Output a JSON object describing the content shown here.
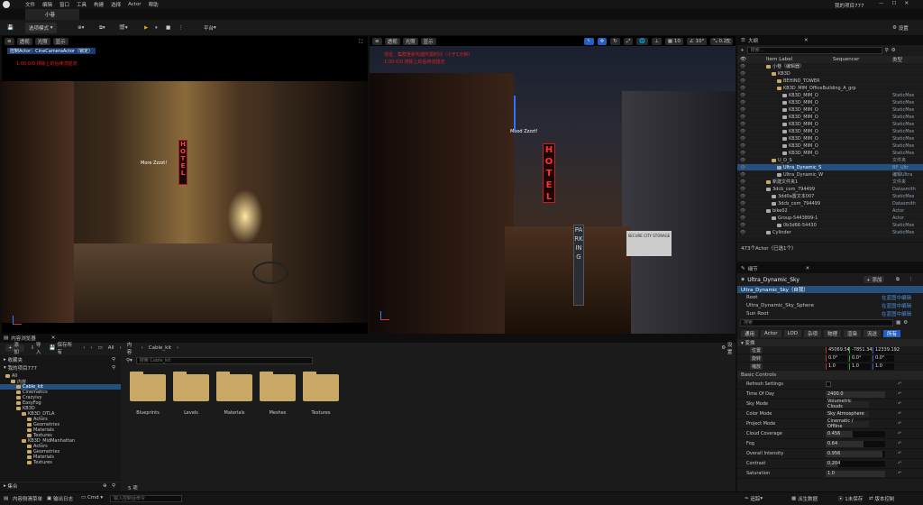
{
  "menu": [
    "文件",
    "编辑",
    "窗口",
    "工具",
    "构建",
    "选择",
    "Actor",
    "帮助"
  ],
  "project_name": "我的项目777",
  "level_tab": "小巷",
  "toolbar": {
    "select_mode": "选项模式",
    "platform": "平台",
    "settings": "设置"
  },
  "viewport_left": {
    "view_mode": "透视",
    "lit": "光照",
    "show": "显示",
    "pilot_text": "控制Actor：CineCameraActor（锁定）",
    "notice": "1:00:0/0 排除上的后续流插流",
    "sign_hotel": "HOTEL",
    "sign_label": "More Zzzzt!"
  },
  "viewport_right": {
    "view_mode": "透视",
    "lit": "光照",
    "show": "显示",
    "error_line1": "地址：集群重新构建所需时间（小于1分钟）",
    "error_line2": "1:00:0/0 排除上的后续流插流",
    "grid": "10",
    "angle": "10°",
    "scale": "0.25",
    "speed": "1",
    "sign_hotel": "HOTEL",
    "sign_parking": "PARKING",
    "sign_label": "Mood Zzzzt!",
    "sign_board": "SECURE CITY STORAGE"
  },
  "outliner": {
    "title": "大纲",
    "search_placeholder": "搜索...",
    "col_label": "Item Label",
    "col_sequencer": "Sequencer",
    "col_type": "类型",
    "rows": [
      {
        "label": "小巷（编辑器）",
        "type": "",
        "indent": 2,
        "sel": false
      },
      {
        "label": "KB3D",
        "type": "",
        "indent": 3,
        "sel": false
      },
      {
        "label": "BEHIND_TOWER",
        "type": "",
        "indent": 4,
        "sel": false
      },
      {
        "label": "KB3D_MIM_OfficeBuilding_A_grp",
        "type": "",
        "indent": 4,
        "sel": false
      },
      {
        "label": "KB3D_MIM_O",
        "type": "StaticMes",
        "indent": 5,
        "sel": false
      },
      {
        "label": "KB3D_MIM_O",
        "type": "StaticMes",
        "indent": 5,
        "sel": false
      },
      {
        "label": "KB3D_MIM_O",
        "type": "StaticMes",
        "indent": 5,
        "sel": false
      },
      {
        "label": "KB3D_MIM_O",
        "type": "StaticMes",
        "indent": 5,
        "sel": false
      },
      {
        "label": "KB3D_MIM_O",
        "type": "StaticMes",
        "indent": 5,
        "sel": false
      },
      {
        "label": "KB3D_MIM_O",
        "type": "StaticMes",
        "indent": 5,
        "sel": false
      },
      {
        "label": "KB3D_MIM_O",
        "type": "StaticMes",
        "indent": 5,
        "sel": false
      },
      {
        "label": "KB3D_MIM_O",
        "type": "StaticMes",
        "indent": 5,
        "sel": false
      },
      {
        "label": "KB3D_MIM_O",
        "type": "StaticMes",
        "indent": 5,
        "sel": false
      },
      {
        "label": "U_D_S",
        "type": "文件夹",
        "indent": 3,
        "sel": false
      },
      {
        "label": "Ultra_Dynamic_S",
        "type": "BP_Ultr",
        "indent": 4,
        "sel": true
      },
      {
        "label": "Ultra_Dynamic_W",
        "type": "编辑Ultra",
        "indent": 4,
        "sel": false
      },
      {
        "label": "新建文件夹1",
        "type": "文件夹",
        "indent": 2,
        "sel": false
      },
      {
        "label": "3dcb_com_794499",
        "type": "Datasmith",
        "indent": 2,
        "sel": false
      },
      {
        "label": "3dd0a置文本007",
        "type": "StaticMes",
        "indent": 3,
        "sel": false
      },
      {
        "label": "3dcb_com_794499",
        "type": "Datasmith",
        "indent": 3,
        "sel": false
      },
      {
        "label": "bike02",
        "type": "Actor",
        "indent": 2,
        "sel": false
      },
      {
        "label": "Group-5443899-1",
        "type": "Actor",
        "indent": 3,
        "sel": false
      },
      {
        "label": "0b3d66-54430",
        "type": "StaticMes",
        "indent": 4,
        "sel": false
      },
      {
        "label": "Cylinder",
        "type": "StaticMes",
        "indent": 2,
        "sel": false
      }
    ],
    "footer": "473个Actor（已选1个）"
  },
  "details": {
    "title": "细节",
    "actor_name": "Ultra_Dynamic_Sky",
    "add_button": "+ 添加",
    "instance": "Ultra_Dynamic_Sky（自我）",
    "components": [
      {
        "name": "Root",
        "action": "在蓝图中编辑"
      },
      {
        "name": "Ultra_Dynamic_Sky_Sphere",
        "action": "在蓝图中编辑"
      },
      {
        "name": "Sun Root",
        "action": "在蓝图中编辑"
      }
    ],
    "search_placeholder": "搜索",
    "category_tabs": [
      "通用",
      "Actor",
      "LOD",
      "杂项",
      "物理",
      "渲染",
      "流送",
      "所有"
    ],
    "transform_title": "变换",
    "transform": [
      {
        "label": "位置",
        "x": "45069.542",
        "y": "-7851.342",
        "z": "12339.192"
      },
      {
        "label": "旋转",
        "x": "0.0°",
        "y": "0.0°",
        "z": "0.0°"
      },
      {
        "label": "缩放",
        "x": "1.0",
        "y": "1.0",
        "z": "1.0"
      }
    ],
    "basic_title": "Basic Controls",
    "props": [
      {
        "label": "Refresh Settings",
        "value": "",
        "kind": "check"
      },
      {
        "label": "Time Of Day",
        "value": "2400.0",
        "kind": "num",
        "fill": 1.0
      },
      {
        "label": "Sky Mode",
        "value": "Volumetric Clouds",
        "kind": "select"
      },
      {
        "label": "Color Mode",
        "value": "Sky Atmosphere",
        "kind": "select"
      },
      {
        "label": "Project Mode",
        "value": "Cinematic / Offline",
        "kind": "select"
      },
      {
        "label": "Cloud Coverage",
        "value": "0.456",
        "kind": "num",
        "fill": 0.456
      },
      {
        "label": "Fog",
        "value": "0.64",
        "kind": "num",
        "fill": 0.64
      },
      {
        "label": "Overall Intensity",
        "value": "0.956",
        "kind": "num",
        "fill": 0.956
      },
      {
        "label": "Contrast",
        "value": "0.204",
        "kind": "num",
        "fill": 0.204
      },
      {
        "label": "Saturation",
        "value": "1.0",
        "kind": "num",
        "fill": 1.0
      }
    ]
  },
  "content_browser": {
    "title": "内容浏览器",
    "add": "添加",
    "import": "导入",
    "save_all": "保存所有",
    "path": [
      "All",
      "内容",
      "Cable_kit"
    ],
    "settings": "设置",
    "favorites": "收藏夹",
    "project": "我的项目777",
    "search_placeholder": "搜索 Cable_kit",
    "tree": [
      {
        "label": "All",
        "indent": 0,
        "sel": false
      },
      {
        "label": "内容",
        "indent": 1,
        "sel": false
      },
      {
        "label": "Cable_kit",
        "indent": 2,
        "sel": true
      },
      {
        "label": "Cinematics",
        "indent": 2,
        "sel": false
      },
      {
        "label": "Crazyivy",
        "indent": 2,
        "sel": false
      },
      {
        "label": "EasyFog",
        "indent": 2,
        "sel": false
      },
      {
        "label": "KB3D",
        "indent": 2,
        "sel": false
      },
      {
        "label": "KB3D_DTLA",
        "indent": 3,
        "sel": false
      },
      {
        "label": "Actors",
        "indent": 4,
        "sel": false
      },
      {
        "label": "Geometries",
        "indent": 4,
        "sel": false
      },
      {
        "label": "Materials",
        "indent": 4,
        "sel": false
      },
      {
        "label": "Textures",
        "indent": 4,
        "sel": false
      },
      {
        "label": "KB3D_MidManhattan",
        "indent": 3,
        "sel": false
      },
      {
        "label": "Actors",
        "indent": 4,
        "sel": false
      },
      {
        "label": "Geometries",
        "indent": 4,
        "sel": false
      },
      {
        "label": "Materials",
        "indent": 4,
        "sel": false
      },
      {
        "label": "Textures",
        "indent": 4,
        "sel": false
      }
    ],
    "folders": [
      "Blueprints",
      "Levels",
      "Materials",
      "Meshes",
      "Textures"
    ],
    "item_count": "5 项",
    "collections": "集合"
  },
  "statusbar": {
    "drawer": "内容侧滑菜单",
    "output_log": "输出日志",
    "cmd": "Cmd",
    "cmd_placeholder": "输入控制台命令",
    "trace": "追踪",
    "derived_data": "派生数据",
    "unsaved": "1未保存",
    "source_control": "版本控制"
  }
}
